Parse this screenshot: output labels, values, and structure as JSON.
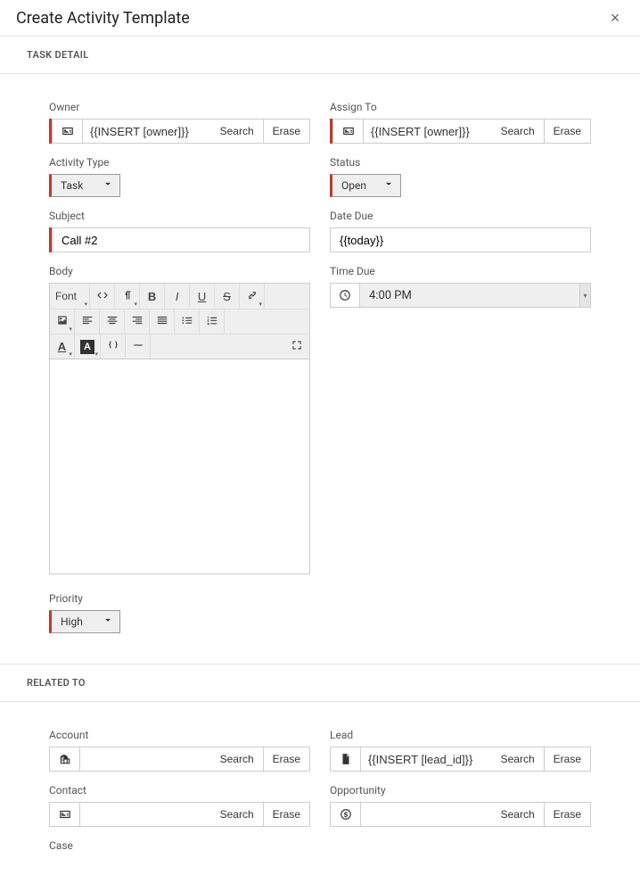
{
  "header": {
    "title": "Create Activity Template"
  },
  "section": {
    "task_detail": "TASK DETAIL",
    "related_to": "RELATED TO"
  },
  "buttons": {
    "search": "Search",
    "erase": "Erase"
  },
  "rte": {
    "font_label": "Font"
  },
  "task": {
    "owner": {
      "label": "Owner",
      "value": "{{INSERT [owner]}}"
    },
    "assign_to": {
      "label": "Assign To",
      "value": "{{INSERT [owner]}}"
    },
    "activity_type": {
      "label": "Activity Type",
      "value": "Task"
    },
    "status": {
      "label": "Status",
      "value": "Open"
    },
    "subject": {
      "label": "Subject",
      "value": "Call #2"
    },
    "date_due": {
      "label": "Date Due",
      "value": "{{today}}"
    },
    "body": {
      "label": "Body"
    },
    "time_due": {
      "label": "Time Due",
      "value": "4:00 PM"
    },
    "priority": {
      "label": "Priority",
      "value": "High"
    }
  },
  "related": {
    "account": {
      "label": "Account",
      "value": ""
    },
    "lead": {
      "label": "Lead",
      "value": "{{INSERT [lead_id]}}"
    },
    "contact": {
      "label": "Contact",
      "value": ""
    },
    "opportunity": {
      "label": "Opportunity",
      "value": ""
    },
    "case": {
      "label": "Case",
      "value": ""
    }
  }
}
